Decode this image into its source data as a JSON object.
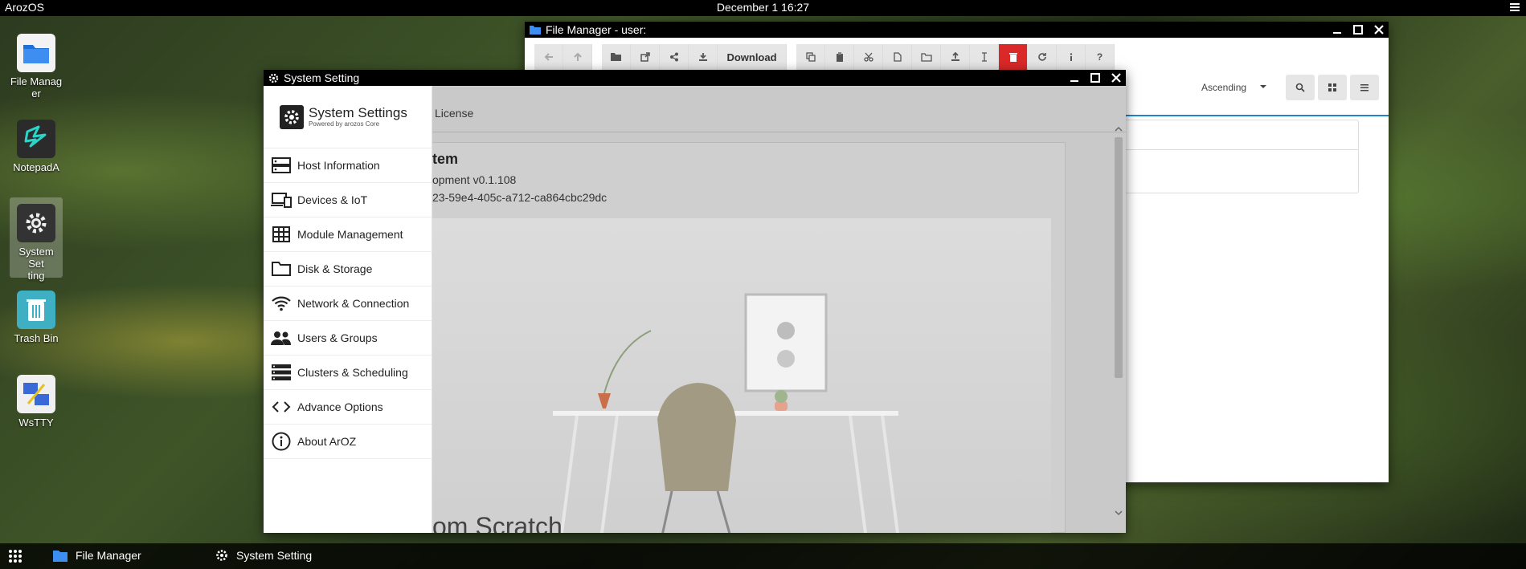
{
  "topbar": {
    "brand": "ArozOS",
    "clock": "December 1 16:27"
  },
  "desktop": {
    "icons": [
      {
        "label": "File Manag\ner"
      },
      {
        "label": "NotepadA"
      },
      {
        "label": "System Set\nting"
      },
      {
        "label": "Trash Bin"
      },
      {
        "label": "WsTTY"
      }
    ]
  },
  "file_manager": {
    "title": "File Manager - user:",
    "toolbar": {
      "download_label": "Download"
    },
    "sort": {
      "selected": "Ascending"
    }
  },
  "system_setting": {
    "title": "System Setting",
    "header": {
      "title": "System Settings",
      "subtitle": "Powered by arozos Core"
    },
    "menu": [
      {
        "label": "Host Information",
        "icon": "server-icon"
      },
      {
        "label": "Devices & IoT",
        "icon": "devices-icon"
      },
      {
        "label": "Module Management",
        "icon": "grid-icon"
      },
      {
        "label": "Disk & Storage",
        "icon": "folder-icon"
      },
      {
        "label": "Network & Connection",
        "icon": "wifi-icon"
      },
      {
        "label": "Users & Groups",
        "icon": "users-icon"
      },
      {
        "label": "Clusters & Scheduling",
        "icon": "cluster-icon"
      },
      {
        "label": "Advance Options",
        "icon": "code-icon"
      },
      {
        "label": "About ArOZ",
        "icon": "info-icon"
      }
    ],
    "content": {
      "tab_label": "License",
      "title_partial": "tem",
      "version_partial": "opment v0.1.108",
      "uuid_partial": "23-59e4-405c-a712-ca864cbc29dc",
      "banner_text_partial": "om Scratch"
    }
  },
  "taskbar": {
    "items": [
      {
        "label": "File Manager"
      },
      {
        "label": "System Setting"
      }
    ]
  },
  "colors": {
    "accent": "#2185d0",
    "delete": "#db2828",
    "titlebar": "#000000"
  }
}
